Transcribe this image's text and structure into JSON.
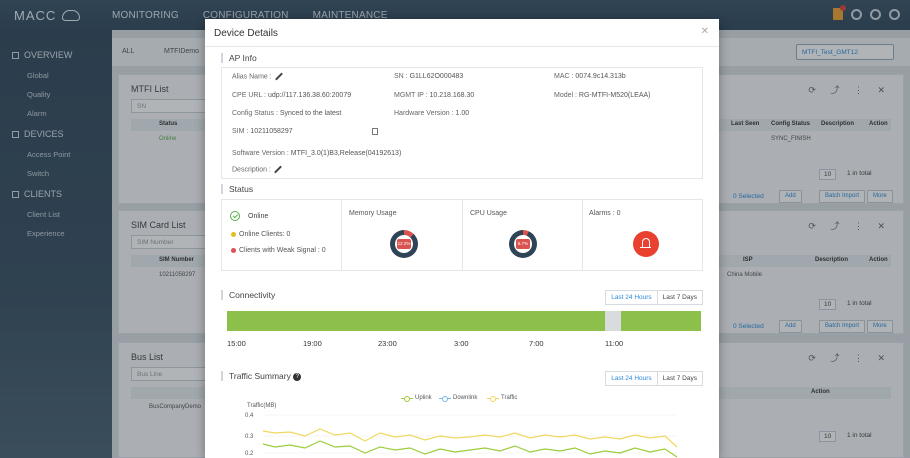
{
  "app": {
    "logo": "MACC",
    "nav": [
      "MONITORING",
      "CONFIGURATION",
      "MAINTENANCE"
    ]
  },
  "sidebar": {
    "sections": [
      {
        "label": "OVERVIEW",
        "items": [
          "Global",
          "Quality",
          "Alarm"
        ]
      },
      {
        "label": "DEVICES",
        "items": [
          "Access Point",
          "Switch"
        ]
      },
      {
        "label": "CLIENTS",
        "items": [
          "Client List",
          "Experience"
        ]
      }
    ]
  },
  "filters": {
    "scope": "ALL",
    "group": "MTFIDemo",
    "project": "MTFI_Test_GMT12"
  },
  "bg_panels": {
    "mtfi": {
      "title": "MTFI List",
      "search": "SN",
      "col_status": "Status",
      "row_status": "Online",
      "col_last_seen": "Last Seen",
      "col_config_status": "Config Status",
      "col_description": "Description",
      "col_action": "Action",
      "config_value": "SYNC_FINISH",
      "page_size": "10",
      "total": "1 in total",
      "selected": "0 Selected",
      "add": "Add",
      "batch": "Batch Import",
      "more": "More"
    },
    "sim": {
      "title": "SIM Card List",
      "search": "SIM Number",
      "col_sim": "SIM Number",
      "row_sim": "10211058297",
      "col_isp": "ISP",
      "isp_value": "China Mobile",
      "col_description": "Description",
      "col_action": "Action",
      "page_size": "10",
      "total": "1 in total",
      "selected": "0 Selected",
      "add": "Add",
      "batch": "Batch Import",
      "more": "More"
    },
    "bus": {
      "title": "Bus List",
      "search": "Bus Line",
      "row_bus": "BusCompanyDemo",
      "col_action": "Action",
      "page_size": "10",
      "total": "1 in total"
    }
  },
  "modal": {
    "title": "Device Details",
    "ap_info": {
      "section_title": "AP Info",
      "alias_label": "Alias Name :",
      "sn_label": "SN :",
      "sn_value": "G1LL62O000483",
      "mac_label": "MAC :",
      "mac_value": "0074.9c14.313b",
      "cpe_label": "CPE URL :",
      "cpe_value": "udp://117.136.38.60:20079",
      "mgmt_label": "MGMT IP :",
      "mgmt_value": "10.218.168.30",
      "model_label": "Model :",
      "model_value": "RG-MTFI-M520(LEAA)",
      "config_label": "Config Status :",
      "config_value": "Synced to the latest",
      "hw_label": "Hardware Version :",
      "hw_value": "1.00",
      "sim_label": "SIM :",
      "sim_value": "10211058297",
      "sw_label": "Software Version :",
      "sw_value": "MTFI_3.0(1)B3,Release(04192613)",
      "desc_label": "Description :"
    },
    "status": {
      "section_title": "Status",
      "online": "Online",
      "online_clients": "Online Clients: 0",
      "weak_clients": "Clients with Weak Signal : 0",
      "memory_label": "Memory Usage",
      "memory_pct": "12.2%",
      "memory_value": 12.2,
      "cpu_label": "CPU Usage",
      "cpu_pct": "6.7%",
      "cpu_value": 6.7,
      "alarms_label": "Alarms : 0"
    },
    "connectivity": {
      "section_title": "Connectivity",
      "tab_24h": "Last 24 Hours",
      "tab_7d": "Last 7 Days",
      "ticks": [
        "15:00",
        "19:00",
        "23:00",
        "3:00",
        "7:00",
        "11:00"
      ]
    },
    "traffic": {
      "section_title": "Traffic Summary",
      "tab_24h": "Last 24 Hours",
      "tab_7d": "Last 7 Days",
      "legend": [
        "Uplink",
        "Downlink",
        "Traffic"
      ],
      "ylabel": "Traffic(MB)",
      "yticks": [
        "0.4",
        "0.3",
        "0.2"
      ]
    }
  },
  "colors": {
    "accent": "#2c8ad8",
    "online": "#58b14a",
    "alarm": "#e8412f",
    "connectivity": "#8cc04b",
    "uplink": "#9ccc3c",
    "traffic": "#f0d860"
  }
}
